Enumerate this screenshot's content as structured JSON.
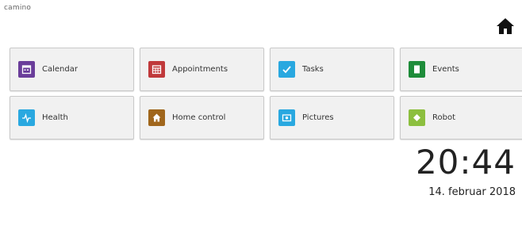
{
  "brand": "camino",
  "home_icon": "home-icon",
  "tiles": [
    {
      "label": "Calendar",
      "color": "#6a3d9a",
      "icon": "calendar-icon"
    },
    {
      "label": "Appointments",
      "color": "#c0393b",
      "icon": "calendar-grid-icon"
    },
    {
      "label": "Tasks",
      "color": "#29a8e0",
      "icon": "checkmark-icon"
    },
    {
      "label": "Events",
      "color": "#1e8c3a",
      "icon": "document-icon"
    },
    {
      "label": "Health",
      "color": "#29a8e0",
      "icon": "heartbeat-icon"
    },
    {
      "label": "Home control",
      "color": "#a0661c",
      "icon": "house-icon"
    },
    {
      "label": "Pictures",
      "color": "#29a8e0",
      "icon": "picture-icon"
    },
    {
      "label": "Robot",
      "color": "#8cbf3f",
      "icon": "robot-icon"
    }
  ],
  "clock": {
    "time": "20:44",
    "date": "14. februar 2018"
  }
}
